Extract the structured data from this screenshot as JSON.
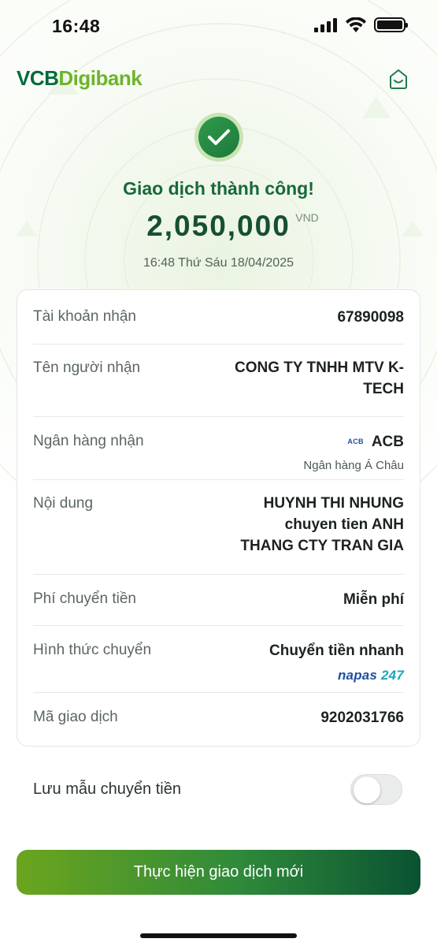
{
  "status_bar": {
    "time": "16:48"
  },
  "header": {
    "logo_vcb": "VCB",
    "logo_digibank": "Digibank"
  },
  "result": {
    "title": "Giao dịch thành công!",
    "amount": "2,050,000",
    "currency": "VND",
    "datetime": "16:48 Thứ Sáu 18/04/2025"
  },
  "details": {
    "account": {
      "label": "Tài khoản nhận",
      "value": "67890098"
    },
    "recipient": {
      "label": "Tên người nhận",
      "value_line1": "CONG TY TNHH MTV K-",
      "value_line2": "TECH"
    },
    "bank": {
      "label": "Ngân hàng nhận",
      "logo": "ACB",
      "value": "ACB",
      "full_name": "Ngân hàng Á Châu"
    },
    "content": {
      "label": "Nội dung",
      "value_line1": "HUYNH THI NHUNG",
      "value_line2": "chuyen tien ANH",
      "value_line3": "THANG CTY TRAN GIA"
    },
    "fee": {
      "label": "Phí chuyển tiền",
      "value": "Miễn phí"
    },
    "method": {
      "label": "Hình thức chuyển",
      "value": "Chuyển tiền nhanh",
      "brand_a": "napas",
      "brand_b": "247"
    },
    "transaction_id": {
      "label": "Mã giao dịch",
      "value": "9202031766"
    }
  },
  "save_template": {
    "label": "Lưu mẫu chuyển tiền",
    "enabled": false
  },
  "actions": {
    "new_transaction": "Thực hiện giao dịch mới"
  },
  "colors": {
    "brand_dark": "#006b3a",
    "brand_light": "#6cb52b",
    "success": "#17683a"
  },
  "icons": [
    "cellular-signal-icon",
    "wifi-icon",
    "battery-icon",
    "home-icon",
    "checkmark-icon",
    "acb-logo-icon",
    "napas-logo"
  ]
}
